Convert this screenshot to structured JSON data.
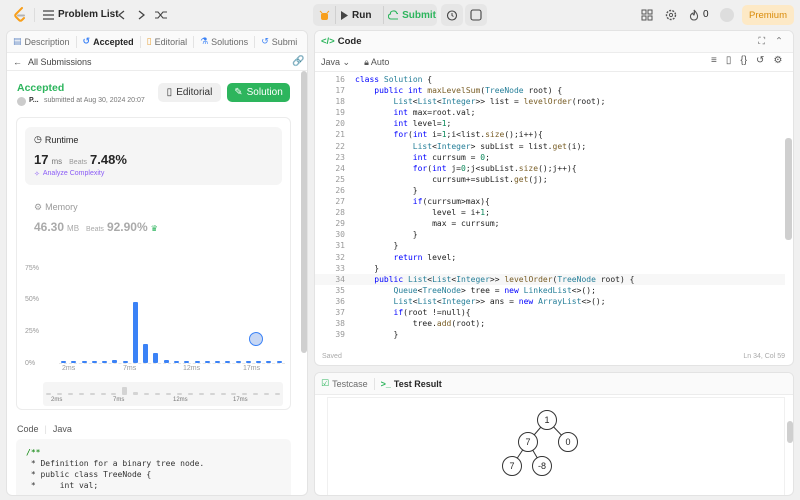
{
  "topbar": {
    "title": "Problem List",
    "run": "Run",
    "submit": "Submit",
    "points": "0",
    "premium": "Premium"
  },
  "left": {
    "tabs": [
      "Description",
      "Accepted",
      "Editorial",
      "Solutions",
      "Submi"
    ],
    "all_submissions": "All Submissions",
    "status": "Accepted",
    "user": "P...",
    "submitted": "submitted at Aug 30, 2024 20:07",
    "editorial_btn": "Editorial",
    "solution_btn": "Solution",
    "runtime": {
      "label": "Runtime",
      "value": "17",
      "unit": "ms",
      "beats_label": "Beats",
      "beats": "7.48%",
      "analyze": "Analyze Complexity"
    },
    "memory": {
      "label": "Memory",
      "value": "46.30",
      "unit": "MB",
      "beats_label": "Beats",
      "beats": "92.90%"
    },
    "code_label": "Code",
    "lang": "Java",
    "code_preview": [
      "/**",
      " * Definition for a binary tree node.",
      " * public class TreeNode {",
      " *     int val;"
    ]
  },
  "chart_data": {
    "type": "bar",
    "yticks": [
      "75%",
      "50%",
      "25%",
      "0%"
    ],
    "xticks": [
      "2ms",
      "7ms",
      "12ms",
      "17ms"
    ],
    "ylim": [
      0,
      75
    ],
    "values": [
      1,
      1,
      1,
      1,
      1,
      2,
      1,
      48,
      15,
      8,
      2,
      1,
      1,
      1,
      1,
      1,
      1,
      1,
      1,
      1,
      1,
      1
    ],
    "highlight_index": 19
  },
  "editor": {
    "title": "Code",
    "lang": "Java",
    "mode": "Auto",
    "saved": "Saved",
    "cursor": "Ln 34, Col 59",
    "start_line": 16,
    "lines": [
      "class Solution {",
      "    public int maxLevelSum(TreeNode root) {",
      "        List<List<Integer>> list = levelOrder(root);",
      "        int max=root.val;",
      "        int level=1;",
      "        for(int i=1;i<list.size();i++){",
      "            List<Integer> subList = list.get(i);",
      "            int currsum = 0;",
      "            for(int j=0;j<subList.size();j++){",
      "                currsum+=subList.get(j);",
      "            }",
      "            if(currsum>max){",
      "                level = i+1;",
      "                max = currsum;",
      "            }",
      "        }",
      "        return level;",
      "    }",
      "    public List<List<Integer>> levelOrder(TreeNode root) {",
      "        Queue<TreeNode> tree = new LinkedList<>();",
      "        List<List<Integer>> ans = new ArrayList<>();",
      "        if(root !=null){",
      "            tree.add(root);",
      "        }"
    ]
  },
  "bottom": {
    "testcase": "Testcase",
    "result": "Test Result",
    "nodes": [
      "1",
      "7",
      "0",
      "7",
      "-8"
    ]
  }
}
